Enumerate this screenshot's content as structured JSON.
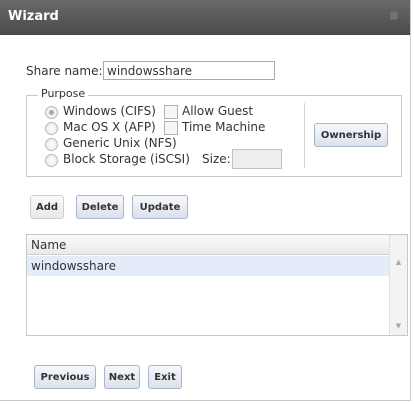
{
  "window": {
    "title": "Wizard",
    "close_symbol": "⊠"
  },
  "share": {
    "label": "Share name:",
    "value": "windowsshare"
  },
  "purpose": {
    "legend": "Purpose",
    "options": [
      {
        "label": "Windows (CIFS)",
        "checked": true
      },
      {
        "label": "Mac OS X (AFP)",
        "checked": false
      },
      {
        "label": "Generic Unix (NFS)",
        "checked": false
      },
      {
        "label": "Block Storage (iSCSI)",
        "checked": false
      }
    ],
    "allow_guest_label": "Allow Guest",
    "time_machine_label": "Time Machine",
    "size_label": "Size:",
    "size_value": "",
    "ownership_label": "Ownership"
  },
  "actions": {
    "add": "Add",
    "delete": "Delete",
    "update": "Update"
  },
  "grid": {
    "header": "Name",
    "rows": [
      "windowsshare"
    ],
    "scroll_up": "▲",
    "scroll_down": "▼"
  },
  "nav": {
    "previous": "Previous",
    "next": "Next",
    "exit": "Exit"
  }
}
